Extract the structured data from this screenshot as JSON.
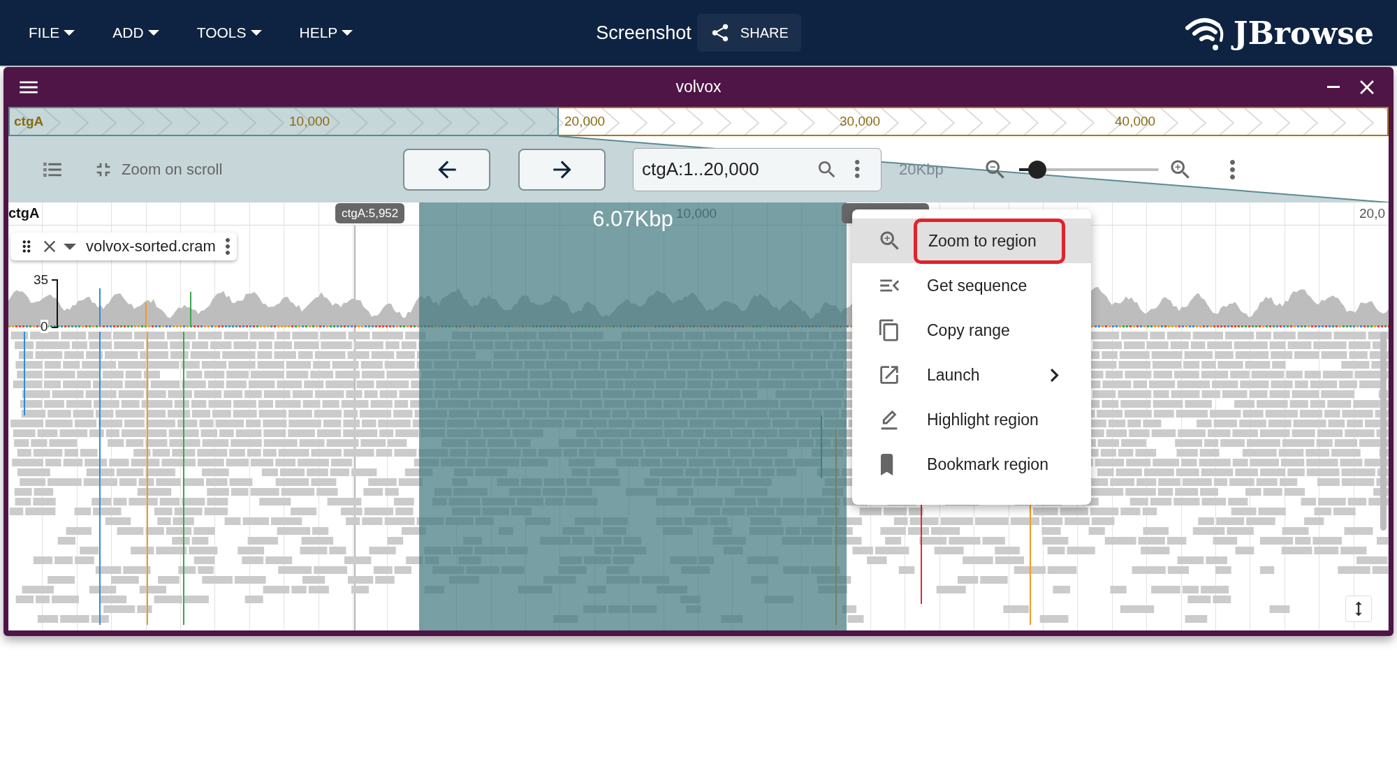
{
  "app_bar": {
    "menus": [
      {
        "label": "FILE"
      },
      {
        "label": "ADD"
      },
      {
        "label": "TOOLS"
      },
      {
        "label": "HELP"
      }
    ],
    "title": "Screenshot",
    "share_button": "SHARE",
    "logo": "JBrowse"
  },
  "view": {
    "title": "volvox",
    "overview": {
      "contig": "ctgA",
      "ticks": [
        "10,000",
        "20,000",
        "30,000",
        "40,000"
      ]
    },
    "toolbar": {
      "zoom_on_scroll": "Zoom on scroll",
      "location": "ctgA:1..20,000",
      "scale": "20Kbp",
      "zoom": {
        "level": 0.13
      }
    },
    "ruler": {
      "contig": "ctgA",
      "ticks": [
        "10,000",
        "20,0"
      ]
    },
    "cursor_position": "ctgA:5,952",
    "selection": {
      "size": "6.07Kbp"
    },
    "track": {
      "name": "volvox-sorted.cram",
      "coverage_ticks": [
        "35",
        "0"
      ]
    }
  },
  "context_menu": {
    "items": [
      {
        "label": "Zoom to region",
        "selected": true,
        "outlined": true,
        "submenu": false
      },
      {
        "label": "Get sequence",
        "selected": false,
        "outlined": false,
        "submenu": false
      },
      {
        "label": "Copy range",
        "selected": false,
        "outlined": false,
        "submenu": false
      },
      {
        "label": "Launch",
        "selected": false,
        "outlined": false,
        "submenu": true
      },
      {
        "label": "Highlight region",
        "selected": false,
        "outlined": false,
        "submenu": false
      },
      {
        "label": "Bookmark region",
        "selected": false,
        "outlined": false,
        "submenu": false
      }
    ]
  }
}
